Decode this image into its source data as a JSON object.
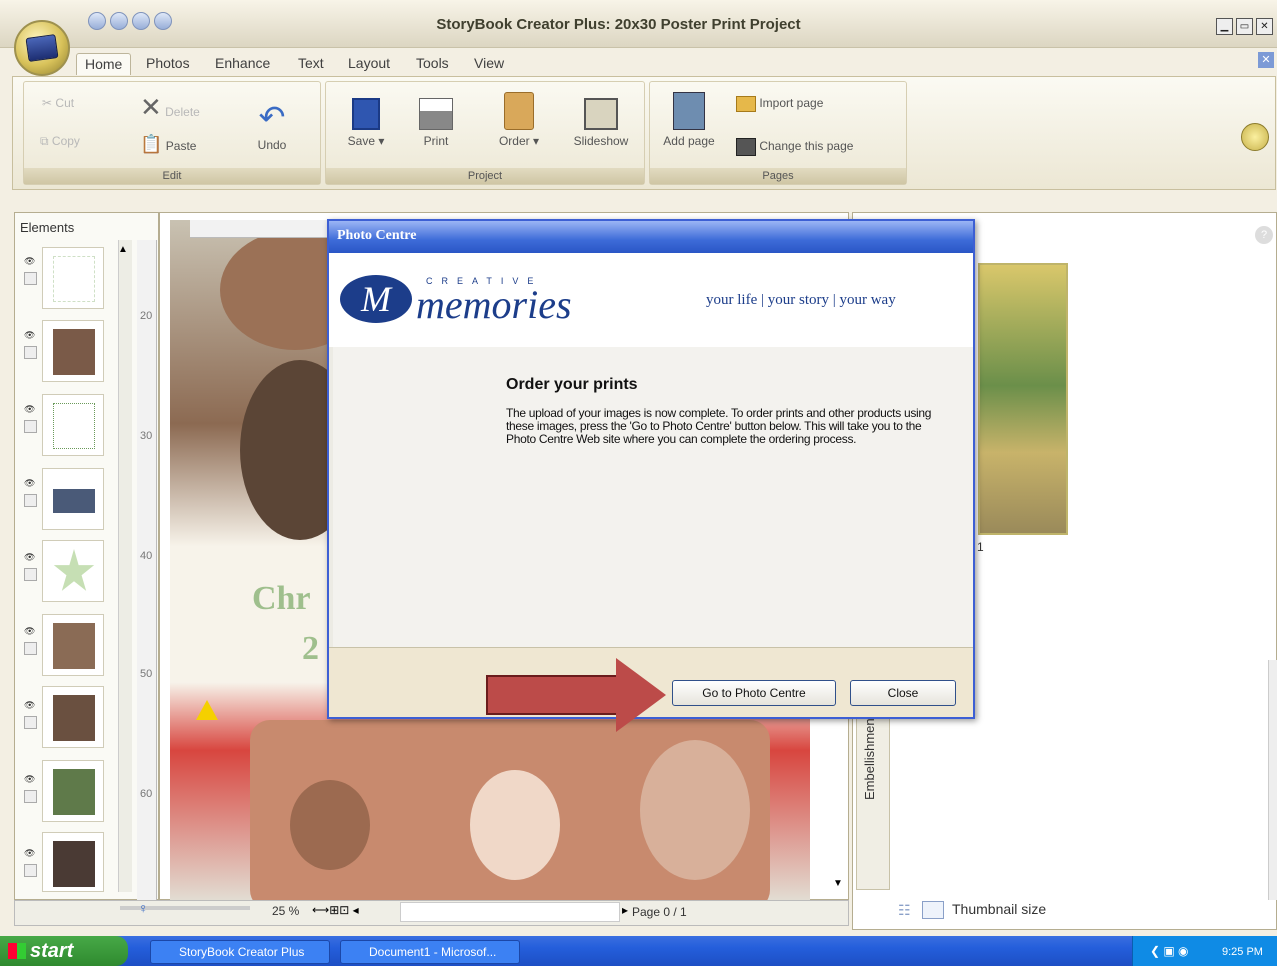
{
  "window": {
    "title": "StoryBook Creator Plus: 20x30 Poster Print Project",
    "controls": [
      "▁",
      "▭",
      "✕"
    ]
  },
  "ribbon": {
    "tabs": [
      {
        "label": "Home",
        "active": true
      },
      {
        "label": "Photos"
      },
      {
        "label": "Enhance"
      },
      {
        "label": "Text"
      },
      {
        "label": "Layout"
      },
      {
        "label": "Tools"
      },
      {
        "label": "View"
      }
    ],
    "groups": {
      "edit": {
        "label": "Edit",
        "cut": "Cut",
        "delete": "Delete",
        "copy": "Copy",
        "paste": "Paste",
        "undo": "Undo"
      },
      "project": {
        "label": "Project",
        "save": "Save",
        "print": "Print",
        "order": "Order",
        "slideshow": "Slideshow"
      },
      "pages": {
        "label": "Pages",
        "add_page": "Add page",
        "import_page": "Import page",
        "change_page": "Change this page"
      }
    }
  },
  "elements_panel": {
    "title": "Elements"
  },
  "canvas": {
    "ruler_left_marks": [
      "20",
      "30",
      "40",
      "50",
      "60"
    ],
    "poster_text": "Chr",
    "poster_text2": "2"
  },
  "status": {
    "zoom": "25 %",
    "page": "Page 0 / 1"
  },
  "right_panel": {
    "page_number": "1",
    "side_tab": "Embellishments",
    "thumbnail_size": "Thumbnail size"
  },
  "dialog": {
    "title": "Photo Centre",
    "logo_small": "CREATIVE",
    "logo_word": "memories",
    "logo_letter": "M",
    "tagline": "your life | your story | your way",
    "heading": "Order your prints",
    "body": "The upload of your images is now complete.  To order prints and other products using these images, press the 'Go to Photo Centre' button below.  This will take you to the Photo Centre Web site where you can complete the ordering process.",
    "go_button": "Go to Photo Centre",
    "close_button": "Close"
  },
  "taskbar": {
    "start": "start",
    "tasks": [
      "StoryBook Creator Plus",
      "Document1 - Microsof..."
    ],
    "clock": "9:25 PM"
  },
  "colors": {
    "accent_blue": "#3d5fd4",
    "arrow_red": "#bc4b49",
    "taskbar": "#245edb",
    "brand": "#1c3d8a"
  }
}
